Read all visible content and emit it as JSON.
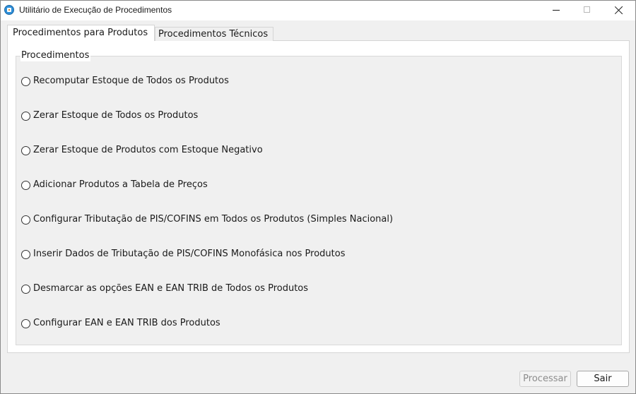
{
  "window": {
    "title": "Utilitário de Execução de Procedimentos",
    "icon": "app-database-icon"
  },
  "tabs": [
    {
      "label": "Procedimentos para Produtos",
      "selected": true
    },
    {
      "label": "Procedimentos Técnicos",
      "selected": false
    }
  ],
  "group": {
    "title": "Procedimentos",
    "options": [
      {
        "label": "Recomputar Estoque de Todos os Produtos",
        "checked": false
      },
      {
        "label": "Zerar Estoque de Todos os Produtos",
        "checked": false
      },
      {
        "label": "Zerar Estoque de Produtos com Estoque Negativo",
        "checked": false
      },
      {
        "label": "Adicionar Produtos a Tabela de Preços",
        "checked": false
      },
      {
        "label": "Configurar Tributação de PIS/COFINS em Todos os Produtos (Simples Nacional)",
        "checked": false
      },
      {
        "label": "Inserir Dados de Tributação de PIS/COFINS Monofásica nos Produtos",
        "checked": false
      },
      {
        "label": "Desmarcar as opções EAN e EAN TRIB de Todos os Produtos",
        "checked": false
      },
      {
        "label": "Configurar EAN e EAN TRIB dos Produtos",
        "checked": false
      }
    ]
  },
  "buttons": {
    "processar": {
      "label": "Processar",
      "enabled": false
    },
    "sair": {
      "label": "Sair",
      "enabled": true
    }
  },
  "colors": {
    "window_bg": "#f0f0f0",
    "panel_bg": "#ffffff",
    "disabled_text": "#8c8c8c"
  }
}
